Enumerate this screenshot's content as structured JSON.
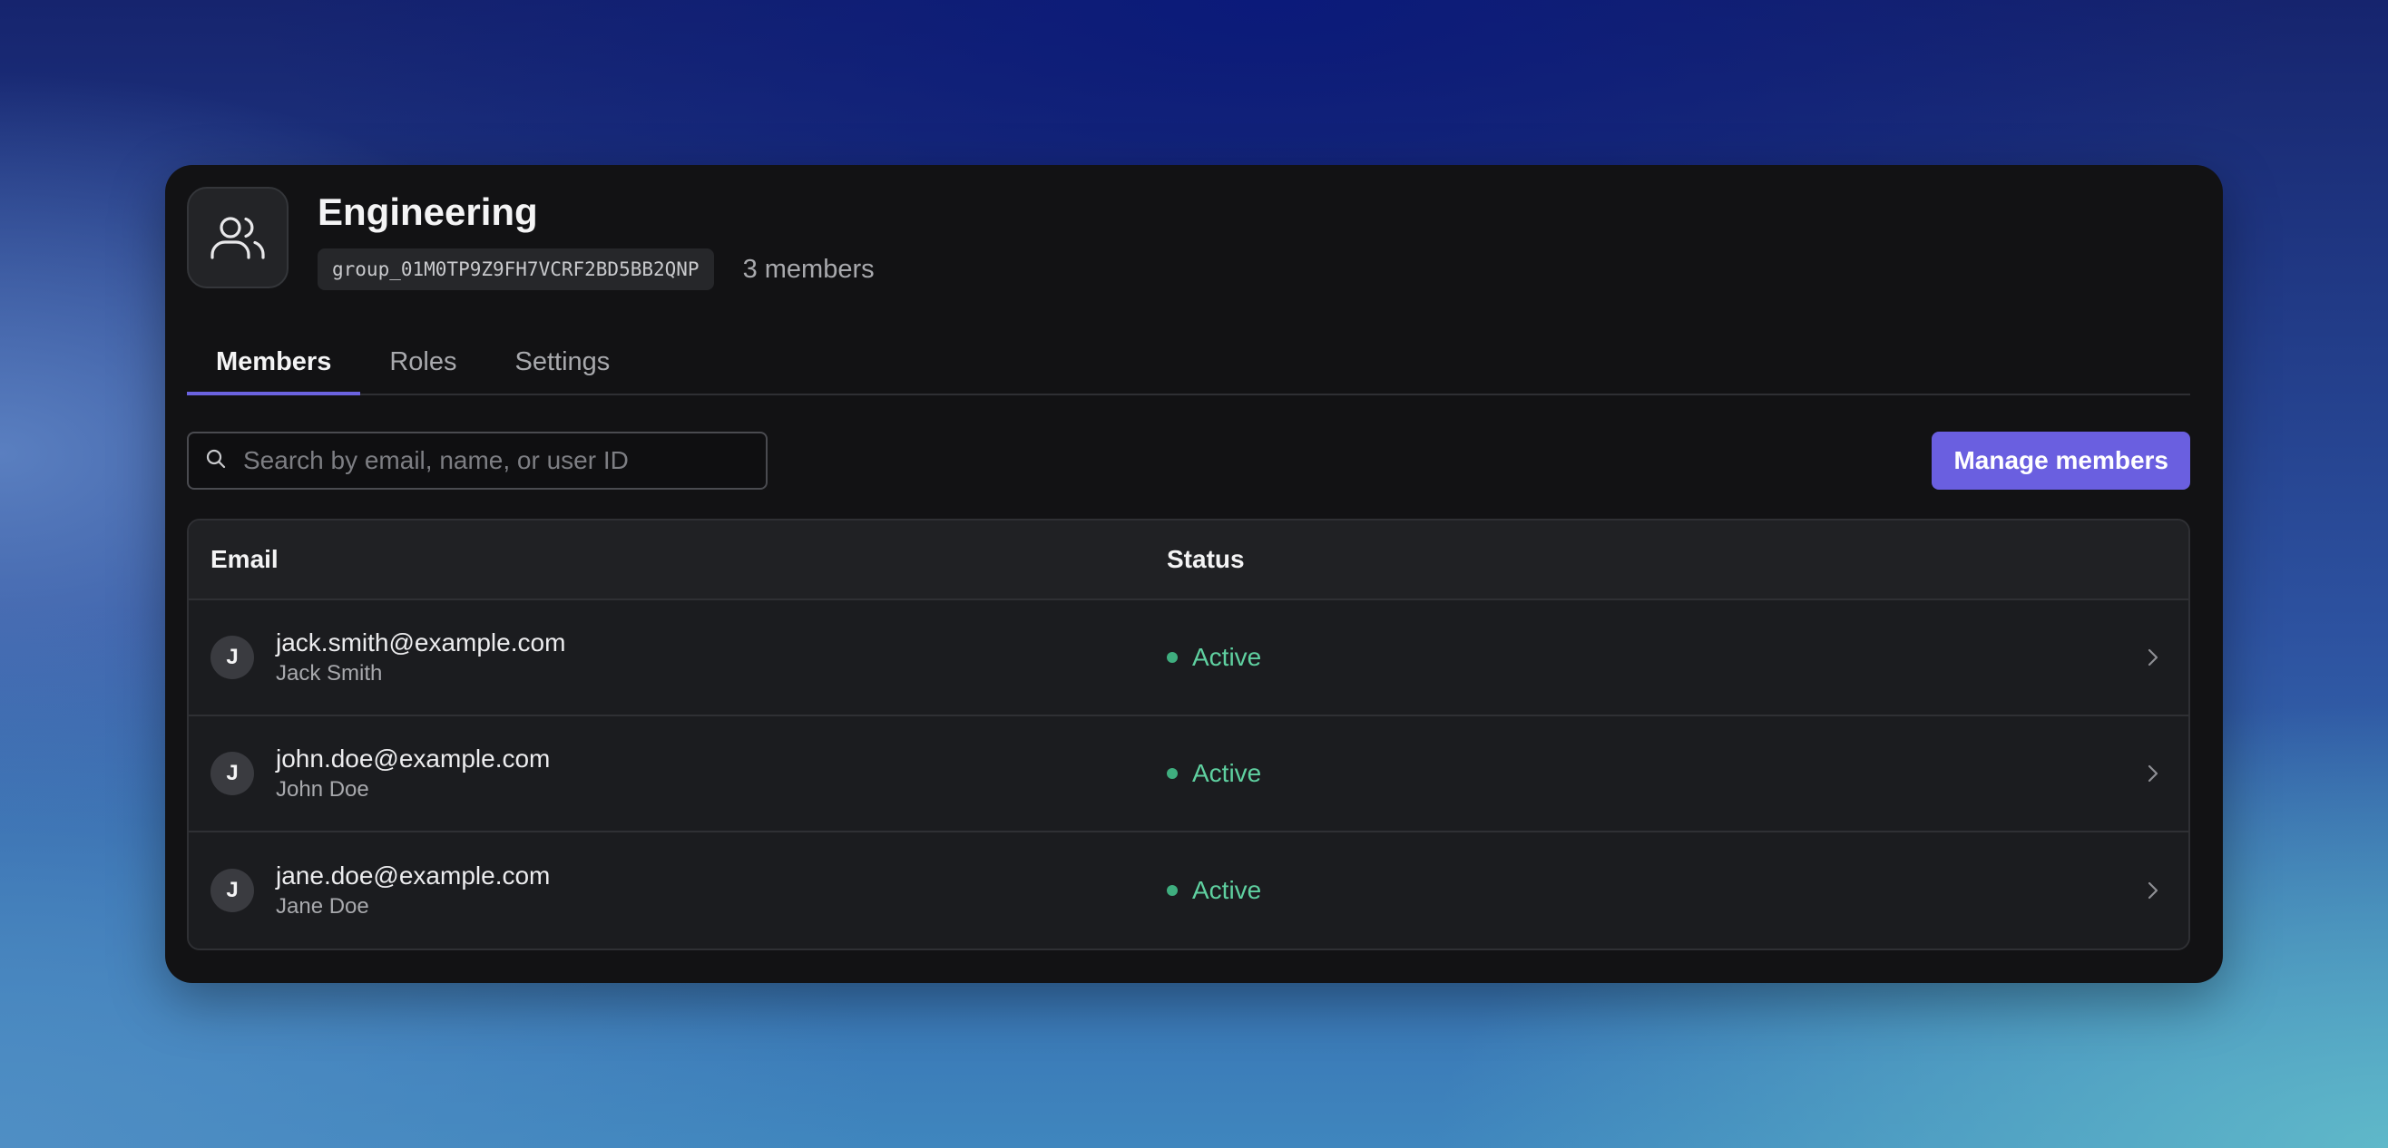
{
  "group": {
    "name": "Engineering",
    "id": "group_01M0TP9Z9FH7VCRF2BD5BB2QNP",
    "member_count": "3 members",
    "icon": "users-icon"
  },
  "tabs": [
    {
      "label": "Members",
      "active": true
    },
    {
      "label": "Roles",
      "active": false
    },
    {
      "label": "Settings",
      "active": false
    }
  ],
  "search": {
    "placeholder": "Search by email, name, or user ID",
    "value": "",
    "icon": "search-icon"
  },
  "actions": {
    "manage_label": "Manage members"
  },
  "table": {
    "headers": {
      "email": "Email",
      "status": "Status"
    },
    "rows": [
      {
        "initial": "J",
        "email": "jack.smith@example.com",
        "name": "Jack Smith",
        "status": "Active"
      },
      {
        "initial": "J",
        "email": "john.doe@example.com",
        "name": "John Doe",
        "status": "Active"
      },
      {
        "initial": "J",
        "email": "jane.doe@example.com",
        "name": "Jane Doe",
        "status": "Active"
      }
    ]
  },
  "colors": {
    "accent": "#6a5fe0",
    "status_active": "#5fd0a0",
    "card_bg": "#121214"
  }
}
